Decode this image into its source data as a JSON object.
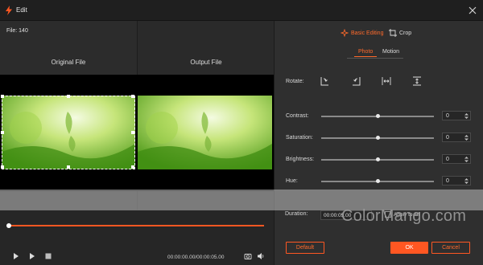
{
  "window": {
    "title": "Edit",
    "close_icon": "close-icon",
    "app_icon": "lightning-icon"
  },
  "left": {
    "file_label": "File: 140",
    "original_label": "Original File",
    "output_label": "Output File"
  },
  "player": {
    "progress_fraction": 0.0,
    "timecode": "00:00:00.00/00:00:05.00",
    "controls": [
      "play-icon",
      "next-frame-icon",
      "stop-icon"
    ],
    "right_controls": [
      "snapshot-icon",
      "volume-icon"
    ]
  },
  "right": {
    "tabs": [
      {
        "label": "Basic Editing",
        "icon": "sparkle-icon",
        "active": true
      },
      {
        "label": "Crop",
        "icon": "crop-icon",
        "active": false
      }
    ],
    "subtabs": [
      {
        "label": "Photo",
        "active": true
      },
      {
        "label": "Motion",
        "active": false
      }
    ],
    "rotate": {
      "label": "Rotate:",
      "buttons": [
        "rotate-right-icon",
        "rotate-left-icon",
        "flip-horizontal-icon",
        "flip-vertical-icon"
      ]
    },
    "adjustments": [
      {
        "label": "Contrast:",
        "value": "0",
        "level": 0.5
      },
      {
        "label": "Saturation:",
        "value": "0",
        "level": 0.5
      },
      {
        "label": "Brightness:",
        "value": "0",
        "level": 0.5
      },
      {
        "label": "Hue:",
        "value": "0",
        "level": 0.5
      }
    ],
    "duration": {
      "label": "Duration:",
      "value": "00:00:05.00"
    },
    "apply_all": "Apply to all",
    "buttons": {
      "default": "Default",
      "ok": "OK",
      "cancel": "Cancel"
    }
  },
  "watermark": "ColorMango.com",
  "colors": {
    "accent": "#ff5722",
    "panel": "#2f2f2f",
    "background": "#262626"
  }
}
